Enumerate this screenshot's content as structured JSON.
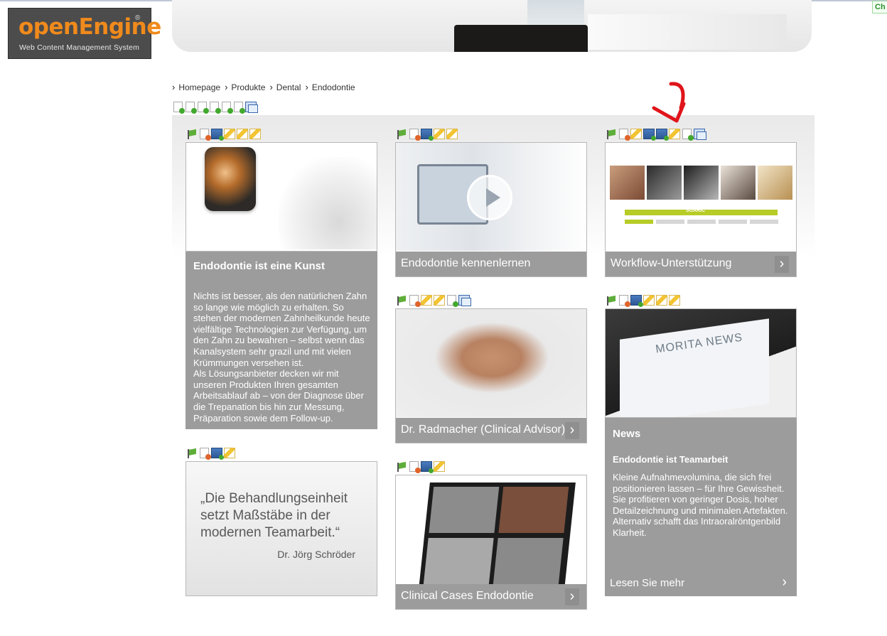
{
  "app": {
    "logo_name": "openEngine",
    "logo_reg": "®",
    "logo_tag": "Web Content Management System",
    "corner_tab": "Ch"
  },
  "breadcrumb": [
    "Homepage",
    "Produkte",
    "Dental",
    "Endodontie"
  ],
  "tiles": {
    "kunst": {
      "title": "Endodontie ist eine Kunst",
      "body": "Nichts ist besser, als den natürlichen Zahn so lange wie möglich zu erhalten. So stehen der modernen Zahnheilkunde heute vielfältige Technologien zur Verfügung, um den Zahn zu bewahren – selbst wenn das Kanalsystem sehr grazil und mit vielen Krümmungen versehen ist.",
      "body2": "Als Lösungsanbieter decken wir mit unseren Produkten Ihren gesamten Arbeitsablauf ab – von der Diagnose über die Trepanation bis hin zur Messung, Präparation sowie dem Follow-up."
    },
    "kennenlernen": {
      "caption": "Endodontie kennenlernen"
    },
    "workflow": {
      "caption": "Workflow-Unterstützung",
      "bar_label": "SOARIC"
    },
    "radmacher": {
      "caption": "Dr. Radmacher (Clinical Advisor)"
    },
    "news": {
      "image_title": "MORITA NEWS",
      "title": "News",
      "subtitle": "Endodontie ist Teamarbeit",
      "body": "Kleine Aufnahmevolumina, die sich frei positionieren lassen – für Ihre Gewissheit. Sie profitieren von geringer Dosis, hoher Detailzeichnung und minimalen Artefakten. Alternativ schafft das Intraoralröntgenbild Klarheit.",
      "link": "Lesen Sie mehr"
    },
    "quote": {
      "text": "„Die Behandlungseinheit setzt Maßstäbe in der modernen Teamarbeit.“",
      "author": "Dr. Jörg Schröder"
    },
    "clinical": {
      "caption": "Clinical Cases Endodontie"
    }
  },
  "chevron": "›",
  "colors": {
    "caption_bg": "#9c9c9c",
    "logo_orange": "#f08a1c",
    "flow_green": "#b7cc27"
  },
  "icons": [
    "page-add-icon",
    "page-delete-icon",
    "flag-icon",
    "pencil-icon",
    "monitor-add-icon",
    "stack-icon"
  ]
}
